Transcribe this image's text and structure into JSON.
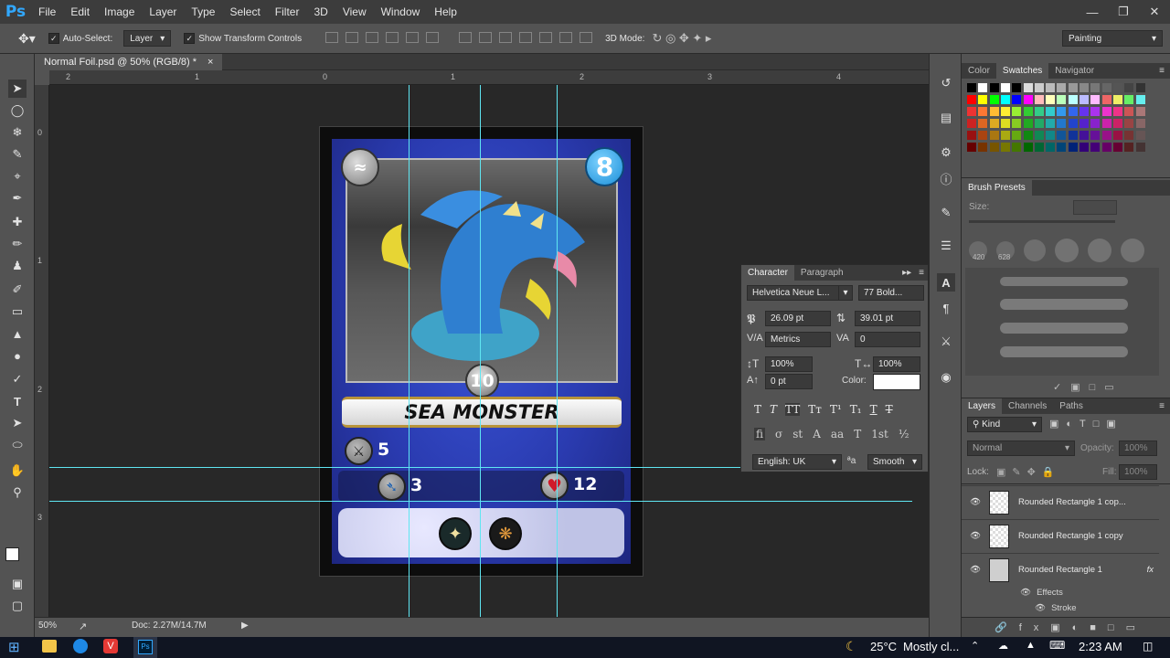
{
  "app": {
    "logo": "Ps"
  },
  "menu": [
    "File",
    "Edit",
    "Image",
    "Layer",
    "Type",
    "Select",
    "Filter",
    "3D",
    "View",
    "Window",
    "Help"
  ],
  "window_controls": {
    "minimize": "—",
    "restore": "❐",
    "close": "✕"
  },
  "options_bar": {
    "auto_select_label": "Auto-Select:",
    "auto_select_value": "Layer",
    "show_transform_label": "Show Transform Controls",
    "mode_3d_label": "3D Mode:",
    "workspace": "Painting"
  },
  "document_tab": {
    "title": "Normal Foil.psd @ 50% (RGB/8) *",
    "close": "×"
  },
  "ruler_top": [
    "2",
    "1",
    "0",
    "1",
    "2",
    "3",
    "4"
  ],
  "ruler_left": [
    "0",
    "1",
    "2",
    "3"
  ],
  "card": {
    "cost": "8",
    "name": "SEA MONSTER",
    "power": "10",
    "stat_sword": "5",
    "stat_speed": "3",
    "stat_health": "12"
  },
  "status": {
    "zoom": "50%",
    "doc": "Doc: 2.27M/14.7M"
  },
  "panels": {
    "color_tabs": [
      "Color",
      "Swatches",
      "Navigator"
    ],
    "color_active": 1,
    "brush_tab": "Brush Presets",
    "brush_size_label": "Size:",
    "brush_sizes": [
      "420",
      "628"
    ],
    "layers_tabs": [
      "Layers",
      "Channels",
      "Paths"
    ],
    "layers_kind": "Kind",
    "blend_mode": "Normal",
    "opacity_label": "Opacity:",
    "opacity_value": "100%",
    "lock_label": "Lock:",
    "fill_label": "Fill:",
    "fill_value": "100%",
    "layers": [
      "Rounded Rectangle 1 cop...",
      "Rounded Rectangle 1 copy",
      "Rounded Rectangle 1"
    ],
    "effects_label": "Effects",
    "stroke_label": "Stroke",
    "fx": "fx"
  },
  "character": {
    "tabs": [
      "Character",
      "Paragraph"
    ],
    "font_family": "Helvetica Neue L...",
    "font_style": "77 Bold...",
    "font_size": "26.09 pt",
    "leading": "39.01 pt",
    "kerning": "Metrics",
    "tracking": "0",
    "vscale": "100%",
    "hscale": "100%",
    "baseline": "0 pt",
    "color_label": "Color:",
    "language": "English: UK",
    "aa_label": "aa",
    "antialias": "Smooth",
    "style_buttons": [
      "T",
      "T",
      "TT",
      "Tт",
      "T¹",
      "T₁",
      "T",
      "T"
    ],
    "ot_buttons": [
      "fi",
      "σ",
      "st",
      "A",
      "aa",
      "T",
      "1st",
      "½"
    ]
  },
  "taskbar": {
    "temp": "25°C",
    "weather": "Mostly cl...",
    "time": "2:23 AM"
  },
  "colors": {
    "ui_dark": "#535353",
    "canvas_bg": "#282828",
    "guide": "#5fe6f2",
    "card_blue": "#2a3bb0",
    "accent_ps": "#31a8ff"
  }
}
